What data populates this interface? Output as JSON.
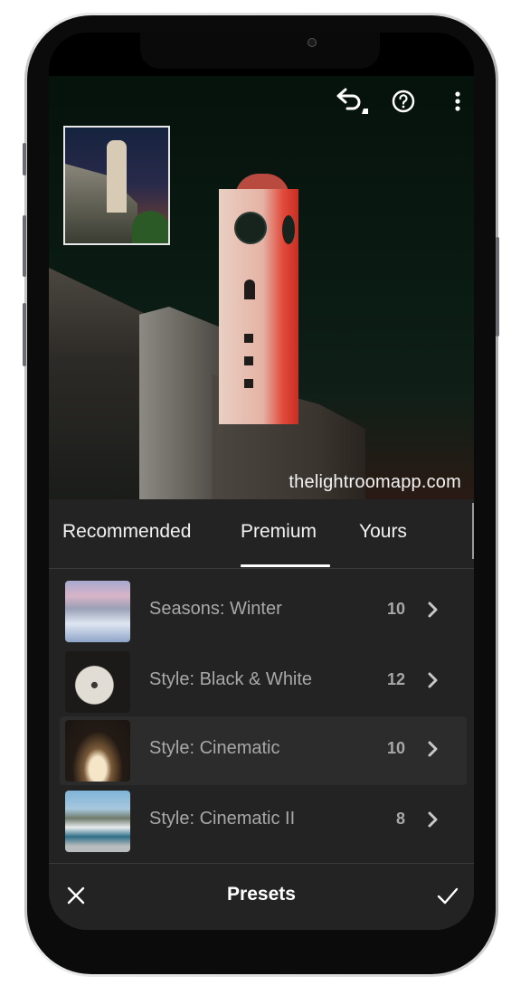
{
  "toolbar": {
    "icons": [
      "undo-icon",
      "help-icon",
      "more-vertical-icon"
    ]
  },
  "photo": {
    "watermark": "thelightroomapp.com"
  },
  "tabs": [
    {
      "label": "Recommended",
      "active": false
    },
    {
      "label": "Premium",
      "active": true
    },
    {
      "label": "Yours",
      "active": false
    }
  ],
  "presets": [
    {
      "name": "Seasons: Winter",
      "count": "10",
      "selected": false,
      "thumb": "winter-mountain"
    },
    {
      "name": "Style: Black & White",
      "count": "12",
      "selected": false,
      "thumb": "white-flower"
    },
    {
      "name": "Style: Cinematic",
      "count": "10",
      "selected": true,
      "thumb": "bridge-arch"
    },
    {
      "name": "Style: Cinematic II",
      "count": "8",
      "selected": false,
      "thumb": "car-street"
    }
  ],
  "footer": {
    "title": "Presets",
    "cancel_icon": "close-icon",
    "confirm_icon": "check-icon"
  },
  "colors": {
    "panel_bg": "#232323",
    "selected_row_bg": "#2c2c2c",
    "text_primary": "#ffffff",
    "text_secondary": "#a8a8a8",
    "active_tab_underline": "#ffffff"
  }
}
